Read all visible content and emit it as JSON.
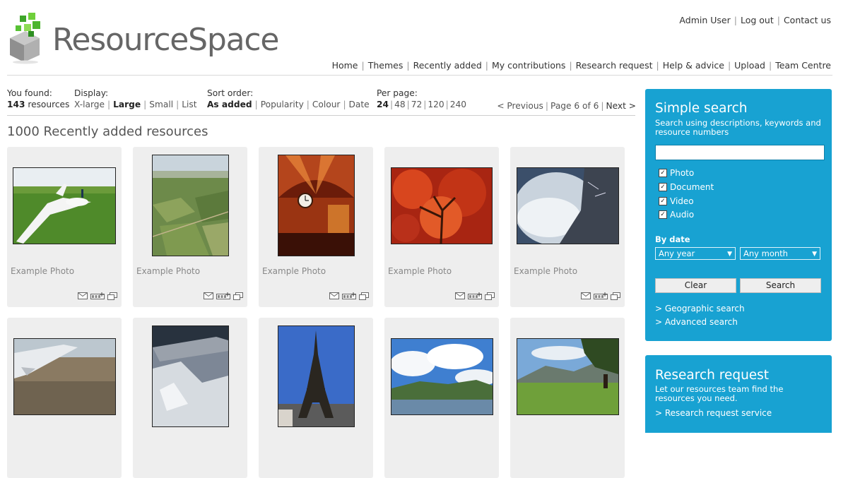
{
  "header": {
    "logo_text": "ResourceSpace",
    "top_links": [
      "Admin User",
      "Log out",
      "Contact us"
    ],
    "main_nav": [
      "Home",
      "Themes",
      "Recently added",
      "My contributions",
      "Research request",
      "Help & advice",
      "Upload",
      "Team Centre"
    ]
  },
  "results": {
    "found_label": "You found:",
    "found_count": "143",
    "found_suffix": "resources",
    "display_label": "Display:",
    "display_options": [
      "X-large",
      "Large",
      "Small",
      "List"
    ],
    "display_selected": "Large",
    "sort_label": "Sort order:",
    "sort_options": [
      "As added",
      "Popularity",
      "Colour",
      "Date"
    ],
    "sort_selected": "As added",
    "perpage_label": "Per page:",
    "perpage_options": [
      "24",
      "48",
      "72",
      "120",
      "240"
    ],
    "perpage_selected": "24",
    "pager": {
      "previous": "< Previous",
      "page_text": "Page 6 of 6",
      "next": "Next >"
    }
  },
  "page_title": "1000 Recently added resources",
  "tiles": [
    {
      "caption": "Example Photo",
      "image": "glider-photo"
    },
    {
      "caption": "Example Photo",
      "image": "aerial-fields-photo"
    },
    {
      "caption": "Example Photo",
      "image": "clock-interior-photo"
    },
    {
      "caption": "Example Photo",
      "image": "red-tree-photo"
    },
    {
      "caption": "Example Photo",
      "image": "wing-clouds-photo"
    },
    {
      "caption": "",
      "image": "wing-land-photo"
    },
    {
      "caption": "",
      "image": "wing-snow-photo"
    },
    {
      "caption": "",
      "image": "eiffel-tower-photo"
    },
    {
      "caption": "",
      "image": "lake-clouds-photo"
    },
    {
      "caption": "",
      "image": "mountain-meadow-photo"
    }
  ],
  "tile_icons": [
    "email-icon",
    "collection-add-icon",
    "preview-icon"
  ],
  "simple_search": {
    "title": "Simple search",
    "description": "Search using descriptions, keywords and resource numbers",
    "input_value": "",
    "types": [
      {
        "label": "Photo",
        "checked": true
      },
      {
        "label": "Document",
        "checked": true
      },
      {
        "label": "Video",
        "checked": true
      },
      {
        "label": "Audio",
        "checked": true
      }
    ],
    "by_date_label": "By date",
    "year_select": "Any year",
    "month_select": "Any month",
    "clear_label": "Clear",
    "search_label": "Search",
    "links": [
      "> Geographic search",
      "> Advanced search"
    ]
  },
  "research_request": {
    "title": "Research request",
    "description": "Let our resources team find the resources you need.",
    "link": "> Research request service"
  },
  "colors": {
    "panel_blue": "#18a2d2",
    "tile_bg": "#eeeeee",
    "logo_green": "#5cbf2a"
  }
}
